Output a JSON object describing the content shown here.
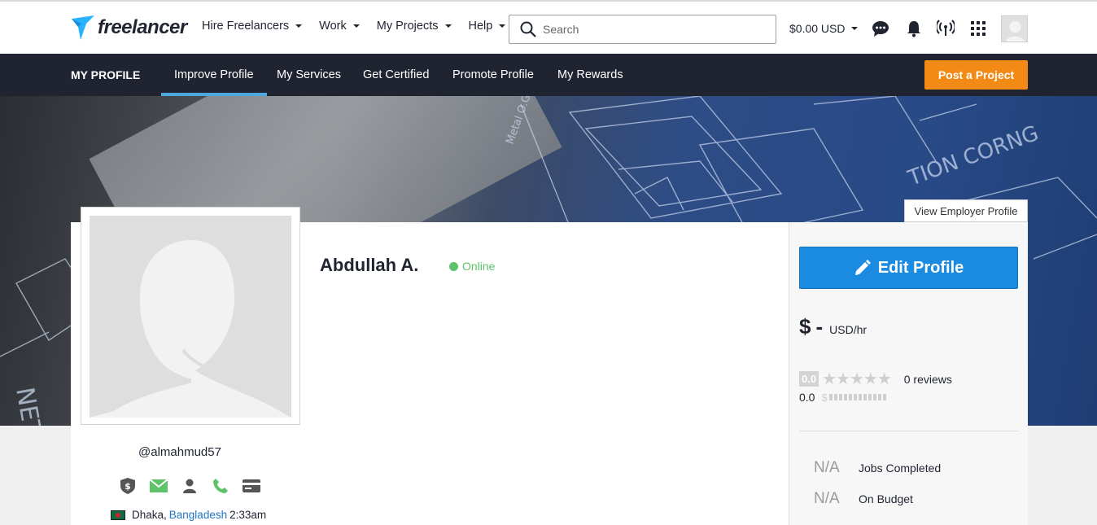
{
  "header": {
    "logo_text": "freelancer",
    "nav": [
      "Hire Freelancers",
      "Work",
      "My Projects",
      "Help"
    ],
    "search_placeholder": "Search",
    "balance": "$0.00 USD"
  },
  "subnav": {
    "title": "MY PROFILE",
    "tabs": [
      "Improve Profile",
      "My Services",
      "Get Certified",
      "Promote Profile",
      "My Rewards"
    ],
    "active_tab": "Improve Profile",
    "post_button": "Post a Project"
  },
  "profile": {
    "name": "Abdullah A.",
    "status": "Online",
    "username": "@almahmud57",
    "city": "Dhaka,",
    "country": "Bangladesh",
    "local_time": "2:33am"
  },
  "side": {
    "view_employer": "View Employer Profile",
    "edit_button": "Edit Profile",
    "rate_currency": "$",
    "rate_value": "-",
    "rate_unit": "USD/hr",
    "rating_badge": "0.0",
    "stars": "★★★★★",
    "reviews": "0 reviews",
    "earnings_score": "0.0",
    "earnings_symbol": "$",
    "stats": [
      {
        "value": "N/A",
        "label": "Jobs Completed"
      },
      {
        "value": "N/A",
        "label": "On Budget"
      }
    ]
  },
  "colors": {
    "accent_blue": "#1a8be0",
    "orange": "#f38a15",
    "navy": "#1f2430",
    "online_green": "#5dc26a"
  }
}
